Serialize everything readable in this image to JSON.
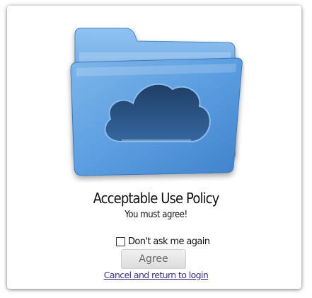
{
  "dialog": {
    "title": "Acceptable Use Policy",
    "subtitle": "You must agree!",
    "checkbox_label": "Don't ask me again",
    "checkbox_checked": false,
    "agree_label": "Agree",
    "cancel_label": "Cancel and return to login"
  },
  "icon": {
    "name": "cloud-folder-icon",
    "folder_color": "#5b9ee0",
    "cloud_color": "#2a4f7f"
  },
  "colors": {
    "link": "#3a2f8a",
    "button_text": "#666666"
  }
}
